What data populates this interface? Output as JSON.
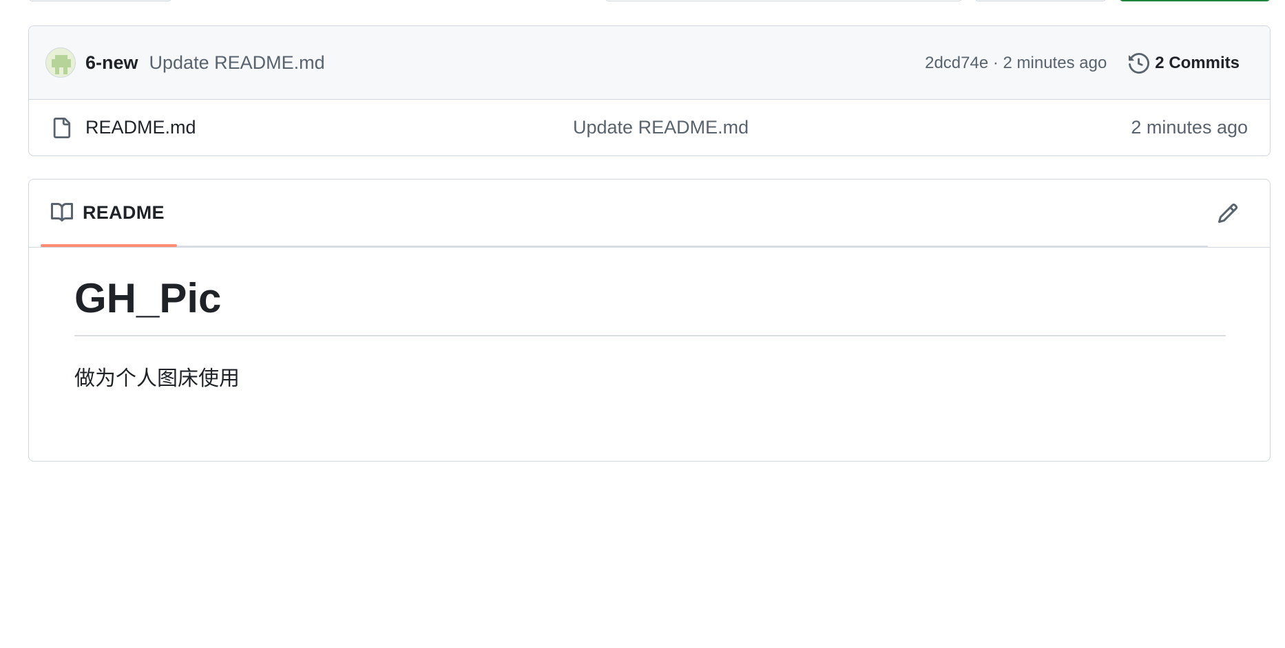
{
  "commit": {
    "author": "6-new",
    "message": "Update README.md",
    "sha_time": "2dcd74e · 2 minutes ago",
    "commits_label": "2 Commits"
  },
  "files": [
    {
      "name": "README.md",
      "last_commit": "Update README.md",
      "age": "2 minutes ago",
      "icon": "file-icon"
    }
  ],
  "readme": {
    "tab_label": "README",
    "title": "GH_Pic",
    "text": "做为个人图床使用"
  },
  "colors": {
    "tab_accent": "#fd8c73",
    "muted_text": "#59636e",
    "border": "#d0d7de",
    "header_bg": "#f6f8fa"
  }
}
